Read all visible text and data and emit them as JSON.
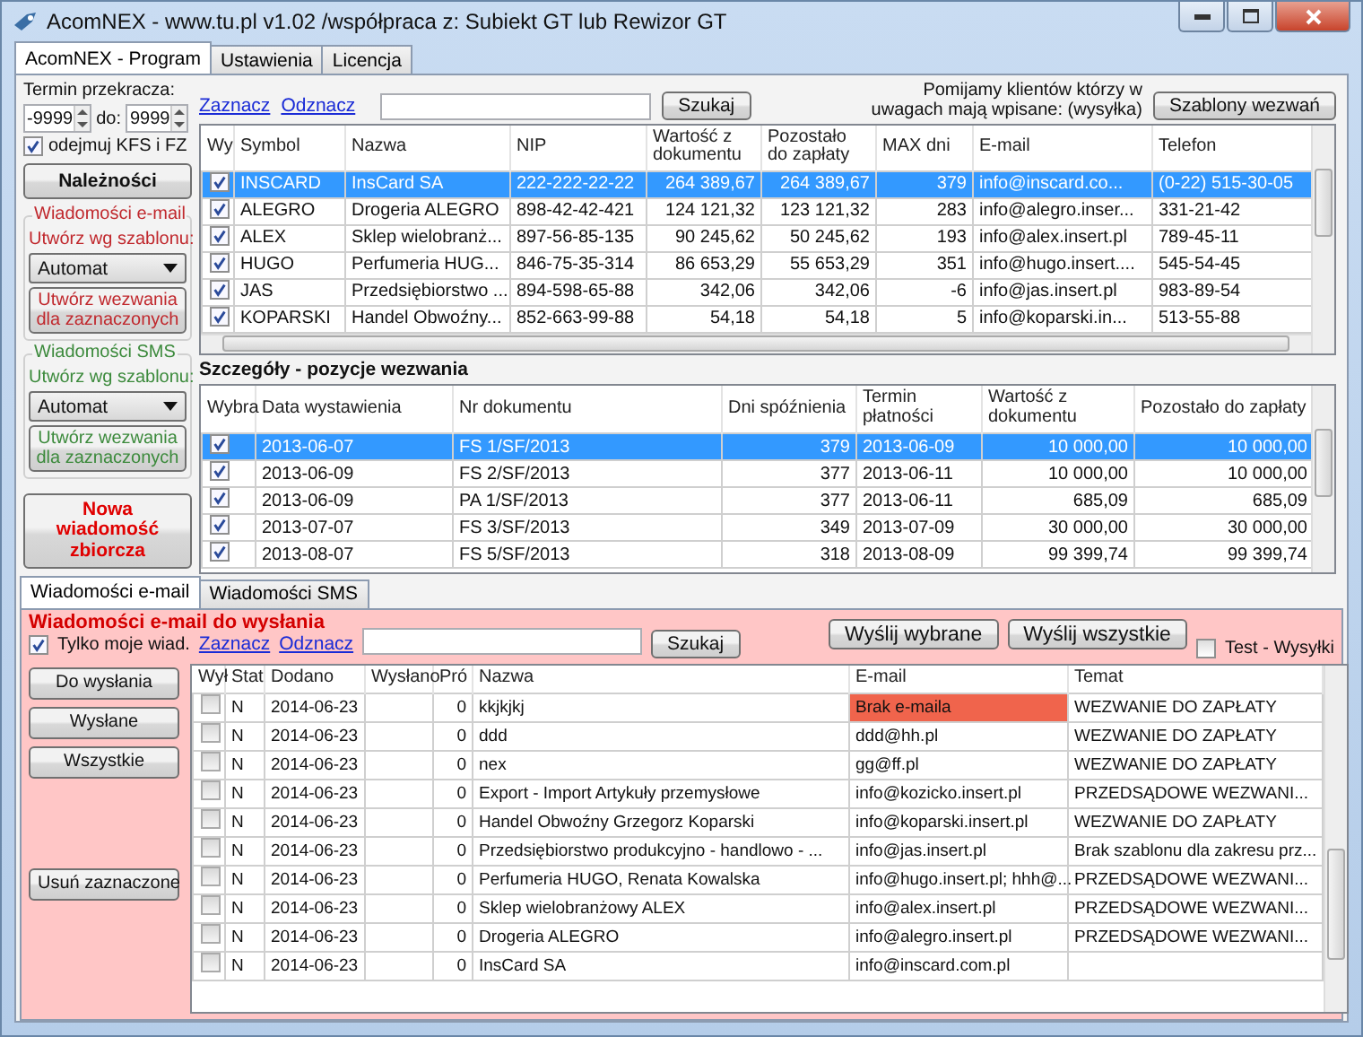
{
  "window": {
    "title": "AcomNEX - www.tu.pl v1.02 /współpraca z: Subiekt GT lub Rewizor GT"
  },
  "tabs": [
    {
      "label": "AcomNEX - Program",
      "selected": true
    },
    {
      "label": "Ustawienia",
      "selected": false
    },
    {
      "label": "Licencja",
      "selected": false
    }
  ],
  "filters": {
    "label": "Termin przekracza:",
    "from": "-9999",
    "to_label": "do:",
    "to": "9999",
    "subtract": {
      "label": "odejmuj KFS i FZ",
      "checked": true
    }
  },
  "receivables_button": "Należności",
  "email_group": {
    "title": "Wiadomości e-mail",
    "template_label": "Utwórz wg szablonu:",
    "template": "Automat",
    "create_button": "Utwórz wezwania dla zaznaczonych"
  },
  "sms_group": {
    "title": "Wiadomości SMS",
    "template_label": "Utwórz wg szablonu:",
    "template": "Automat",
    "create_button": "Utwórz wezwania dla zaznaczonych"
  },
  "bulk_button": "Nowa wiadomość zbiorcza",
  "toolbar": {
    "select_link": "Zaznacz",
    "deselect_link": "Odznacz",
    "search_button": "Szukaj",
    "note": "Pomijamy klientów którzy w uwagach mają wpisane: (wysyłka)",
    "templates_button": "Szablony wezwań"
  },
  "clients": {
    "check_column": "Wy",
    "columns": [
      "Symbol",
      "Nazwa",
      "NIP",
      "Wartość z dokumentu",
      "Pozostało do zapłaty",
      "MAX dni",
      "E-mail",
      "Telefon"
    ],
    "rows": [
      {
        "checked": true,
        "selected": true,
        "cells": [
          "INSCARD",
          "InsCard SA",
          "222-222-22-22",
          "264 389,67",
          "264 389,67",
          "379",
          "info@inscard.co...",
          "(0-22) 515-30-05"
        ]
      },
      {
        "checked": true,
        "selected": false,
        "cells": [
          "ALEGRO",
          "Drogeria ALEGRO",
          "898-42-42-421",
          "124 121,32",
          "123 121,32",
          "283",
          "info@alegro.inser...",
          "331-21-42"
        ]
      },
      {
        "checked": true,
        "selected": false,
        "cells": [
          "ALEX",
          "Sklep wielobranż...",
          "897-56-85-135",
          "90 245,62",
          "50 245,62",
          "193",
          "info@alex.insert.pl",
          "789-45-11"
        ]
      },
      {
        "checked": true,
        "selected": false,
        "cells": [
          "HUGO",
          "Perfumeria HUG...",
          "846-75-35-314",
          "86 653,29",
          "55 653,29",
          "351",
          "info@hugo.insert....",
          "545-54-45"
        ]
      },
      {
        "checked": true,
        "selected": false,
        "cells": [
          "JAS",
          "Przedsiębiorstwo ...",
          "894-598-65-88",
          "342,06",
          "342,06",
          "-6",
          "info@jas.insert.pl",
          "983-89-54"
        ]
      },
      {
        "checked": true,
        "selected": false,
        "cells": [
          "KOPARSKI",
          "Handel Obwoźny...",
          "852-663-99-88",
          "54,18",
          "54,18",
          "5",
          "info@koparski.in...",
          "513-55-88"
        ]
      }
    ]
  },
  "details": {
    "title": "Szczegóły - pozycje wezwania",
    "check_column": "Wybra",
    "columns": [
      "Data wystawienia",
      "Nr dokumentu",
      "Dni spóźnienia",
      "Termin płatności",
      "Wartość z dokumentu",
      "Pozostało do zapłaty"
    ],
    "rows": [
      {
        "checked": true,
        "selected": true,
        "cells": [
          "2013-06-07",
          "FS 1/SF/2013",
          "379",
          "2013-06-09",
          "10 000,00",
          "10 000,00"
        ]
      },
      {
        "checked": true,
        "selected": false,
        "cells": [
          "2013-06-09",
          "FS 2/SF/2013",
          "377",
          "2013-06-11",
          "10 000,00",
          "10 000,00"
        ]
      },
      {
        "checked": true,
        "selected": false,
        "cells": [
          "2013-06-09",
          "PA 1/SF/2013",
          "377",
          "2013-06-11",
          "685,09",
          "685,09"
        ]
      },
      {
        "checked": true,
        "selected": false,
        "cells": [
          "2013-07-07",
          "FS 3/SF/2013",
          "349",
          "2013-07-09",
          "30 000,00",
          "30 000,00"
        ]
      },
      {
        "checked": true,
        "selected": false,
        "cells": [
          "2013-08-07",
          "FS 5/SF/2013",
          "318",
          "2013-08-09",
          "99 399,74",
          "99 399,74"
        ]
      }
    ]
  },
  "message_tabs": [
    {
      "label": "Wiadomości e-mail",
      "selected": true
    },
    {
      "label": "Wiadomości SMS",
      "selected": false
    }
  ],
  "outbox": {
    "title": "Wiadomości e-mail do wysłania",
    "only_mine": {
      "label": "Tylko moje wiad.",
      "checked": true
    },
    "select_link": "Zaznacz",
    "deselect_link": "Odznacz",
    "search_button": "Szukaj",
    "send_selected": "Wyślij wybrane",
    "send_all": "Wyślij wszystkie",
    "test": {
      "label": "Test - Wysyłki",
      "checked": false
    },
    "filter_buttons": [
      "Do wysłania",
      "Wysłane",
      "Wszystkie"
    ],
    "delete_button": "Usuń zaznaczone",
    "check_column": "Wył",
    "columns": [
      "Stat",
      "Dodano",
      "Wysłano",
      "Pró",
      "Nazwa",
      "E-mail",
      "Temat"
    ],
    "rows": [
      {
        "checked": false,
        "email_missing": true,
        "cells": [
          "N",
          "2014-06-23",
          "",
          "0",
          "kkjkjkj",
          "Brak e-maila",
          "WEZWANIE DO ZAPŁATY"
        ]
      },
      {
        "checked": false,
        "email_missing": false,
        "cells": [
          "N",
          "2014-06-23",
          "",
          "0",
          "ddd",
          "ddd@hh.pl",
          "WEZWANIE DO ZAPŁATY"
        ]
      },
      {
        "checked": false,
        "email_missing": false,
        "cells": [
          "N",
          "2014-06-23",
          "",
          "0",
          "nex",
          "gg@ff.pl",
          "WEZWANIE DO ZAPŁATY"
        ]
      },
      {
        "checked": false,
        "email_missing": false,
        "cells": [
          "N",
          "2014-06-23",
          "",
          "0",
          "Export - Import Artykuły przemysłowe",
          "info@kozicko.insert.pl",
          "PRZEDSĄDOWE WEZWANI..."
        ]
      },
      {
        "checked": false,
        "email_missing": false,
        "cells": [
          "N",
          "2014-06-23",
          "",
          "0",
          "Handel Obwoźny Grzegorz Koparski",
          "info@koparski.insert.pl",
          "WEZWANIE DO ZAPŁATY"
        ]
      },
      {
        "checked": false,
        "email_missing": false,
        "cells": [
          "N",
          "2014-06-23",
          "",
          "0",
          "Przedsiębiorstwo produkcyjno - handlowo - ...",
          "info@jas.insert.pl",
          "Brak szablonu dla zakresu prz..."
        ]
      },
      {
        "checked": false,
        "email_missing": false,
        "cells": [
          "N",
          "2014-06-23",
          "",
          "0",
          "Perfumeria HUGO, Renata Kowalska",
          "info@hugo.insert.pl; hhh@...",
          "PRZEDSĄDOWE WEZWANI..."
        ]
      },
      {
        "checked": false,
        "email_missing": false,
        "cells": [
          "N",
          "2014-06-23",
          "",
          "0",
          "Sklep wielobranżowy  ALEX",
          "info@alex.insert.pl",
          "PRZEDSĄDOWE WEZWANI..."
        ]
      },
      {
        "checked": false,
        "email_missing": false,
        "cells": [
          "N",
          "2014-06-23",
          "",
          "0",
          "Drogeria ALEGRO",
          "info@alegro.insert.pl",
          "PRZEDSĄDOWE WEZWANI..."
        ]
      },
      {
        "checked": false,
        "email_missing": false,
        "cells": [
          "N",
          "2014-06-23",
          "",
          "0",
          "InsCard SA",
          "info@inscard.com.pl",
          ""
        ]
      }
    ]
  }
}
